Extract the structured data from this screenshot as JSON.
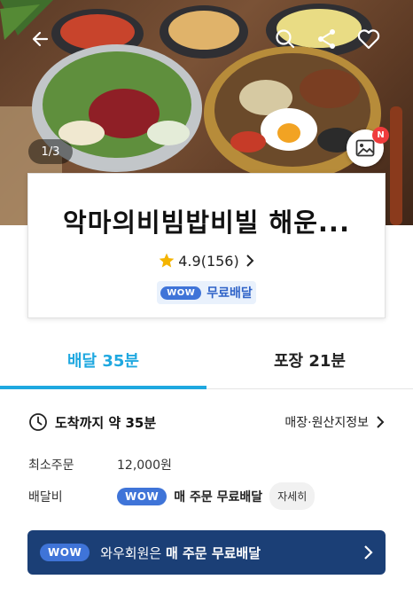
{
  "hero": {
    "page_indicator": "1/3",
    "new_badge": "N",
    "icons": [
      "back-arrow-icon",
      "search-icon",
      "share-icon",
      "heart-icon",
      "gallery-icon"
    ]
  },
  "store": {
    "name": "악마의비빔밥비빌 해운...",
    "rating": "4.9",
    "review_count": "(156)",
    "wow_label": "WOW",
    "free_delivery": "무료배달"
  },
  "tabs": [
    {
      "label": "배달 35분",
      "active": true
    },
    {
      "label": "포장 21분",
      "active": false
    }
  ],
  "delivery": {
    "arrival": "도착까지 약 35분",
    "origin_link": "매장·원산지정보",
    "min_order_label": "최소주문",
    "min_order_value": "12,000원",
    "fee_label": "배달비",
    "fee_wow": "WOW",
    "fee_value": "매 주문 무료배달",
    "detail_button": "자세히"
  },
  "banner": {
    "wow": "WOW",
    "text_prefix": "와우회원은 ",
    "text_bold": "매 주문 무료배달"
  },
  "colors": {
    "accent": "#1fa8e0",
    "wow_blue": "#3f74d8",
    "banner_navy": "#1b3f76",
    "badge_red": "#ef3c3c"
  }
}
